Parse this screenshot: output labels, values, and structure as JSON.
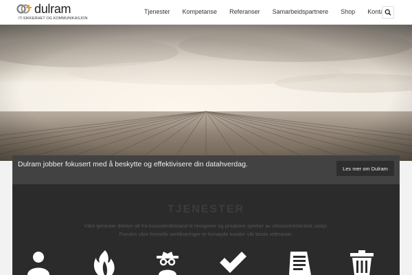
{
  "brand": {
    "name": "dulram",
    "tagline": "IT-SIKKERHET OG KOMMUNIKASJON",
    "accent_color": "#f29a2e"
  },
  "nav": {
    "items": [
      {
        "label": "Tjenester"
      },
      {
        "label": "Kompetanse"
      },
      {
        "label": "Referanser"
      },
      {
        "label": "Samarbeidspartnere"
      },
      {
        "label": "Shop"
      },
      {
        "label": "Kontakt"
      }
    ],
    "search_icon": "search-icon"
  },
  "intro": {
    "text": "Dulram jobber fokusert med å beskytte og effektivisere din datahverdag.",
    "button_label": "Les mer om Dulram"
  },
  "services": {
    "title": "TJENESTER",
    "description_line1": "Våre tjenester dekker alt fra konsulentbistand til revisjoner og proaktive sjekker av virksomhetskritisk utstyr.",
    "description_line2": "Foruten våre formelle sertifiseringer er fornøyde kunder vår beste referanse.",
    "icons": [
      "user-icon",
      "flame-icon",
      "spy-icon",
      "checkmark-icon",
      "document-icon",
      "trash-icon"
    ]
  }
}
